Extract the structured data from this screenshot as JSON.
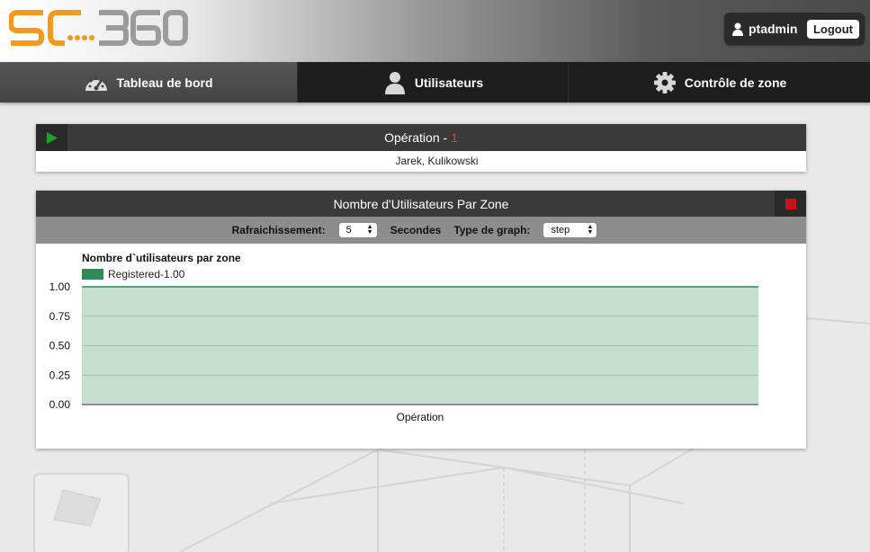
{
  "header": {
    "logo_text": "SC360",
    "username": "ptadmin",
    "logout_label": "Logout"
  },
  "nav": {
    "items": [
      {
        "label": "Tableau de bord",
        "icon": "dashboard-icon",
        "active": true
      },
      {
        "label": "Utilisateurs",
        "icon": "user-icon",
        "active": false
      },
      {
        "label": "Contrôle de zone",
        "icon": "gear-icon",
        "active": false
      }
    ]
  },
  "operation_panel": {
    "title": "Opération - ",
    "count": "1",
    "user": "Jarek, Kulikowski"
  },
  "chart_panel": {
    "title": "Nombre d'Utilisateurs Par Zone",
    "refresh_label": "Rafraichissement:",
    "refresh_value": "5",
    "seconds_label": "Secondes",
    "graph_type_label": "Type de graph:",
    "graph_type_value": "step"
  },
  "chart_data": {
    "type": "area",
    "title": "Nombre d`utilisateurs par zone",
    "categories": [
      "Opération"
    ],
    "series": [
      {
        "name": "Registered-1.00",
        "values": [
          1.0
        ],
        "color": "#2e8b57"
      }
    ],
    "ylim": [
      0,
      1
    ],
    "yticks": [
      "1.00",
      "0.75",
      "0.50",
      "0.25",
      "0.00"
    ],
    "grid": true,
    "legend": "top-left",
    "fill_color": "#c4dfcf",
    "line_color": "#2e8b57"
  }
}
